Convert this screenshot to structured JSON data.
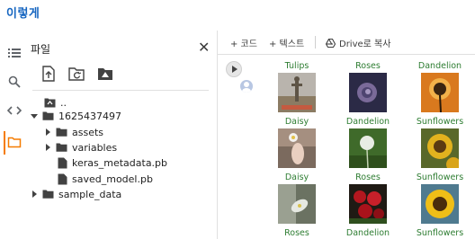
{
  "app": {
    "title": "이렇게"
  },
  "files_panel": {
    "title": "파일",
    "close_glyph": "✕",
    "tools": [
      "upload-file-icon",
      "refresh-folder-icon",
      "mount-drive-icon"
    ],
    "tree": [
      {
        "label": "..",
        "kind": "parent",
        "expanded": false
      },
      {
        "label": "1625437497",
        "kind": "folder",
        "expanded": true
      },
      {
        "label": "assets",
        "kind": "folder",
        "expanded": false
      },
      {
        "label": "variables",
        "kind": "folder",
        "expanded": false
      },
      {
        "label": "keras_metadata.pb",
        "kind": "file"
      },
      {
        "label": "saved_model.pb",
        "kind": "file"
      },
      {
        "label": "sample_data",
        "kind": "folder",
        "expanded": false
      }
    ]
  },
  "toolbar": {
    "add_code": "+ 코드",
    "add_text": "+ 텍스트",
    "drive_copy": "Drive로 복사"
  },
  "output_grid": {
    "label_color": "#2e7d32",
    "tiles": [
      {
        "label": "Tulips",
        "icon": "tulips-photo"
      },
      {
        "label": "Roses",
        "icon": "rose-photo"
      },
      {
        "label": "Dandelion",
        "icon": "dandelion-photo"
      },
      {
        "label": "Daisy",
        "icon": "daisy-photo"
      },
      {
        "label": "Dandelion",
        "icon": "dandelion-photo"
      },
      {
        "label": "Sunflowers",
        "icon": "sunflower-photo"
      },
      {
        "label": "Daisy",
        "icon": "daisy-photo"
      },
      {
        "label": "Roses",
        "icon": "rose-photo"
      },
      {
        "label": "Sunflowers",
        "icon": "sunflower-photo"
      },
      {
        "label": "Roses",
        "icon": "rose-photo"
      },
      {
        "label": "Dandelion",
        "icon": "dandelion-photo"
      },
      {
        "label": "Sunflowers",
        "icon": "sunflower-photo"
      }
    ]
  },
  "colors": {
    "title": "#1565c0",
    "active_rail": "#f57c00",
    "tile_label": "#2e7d32"
  }
}
